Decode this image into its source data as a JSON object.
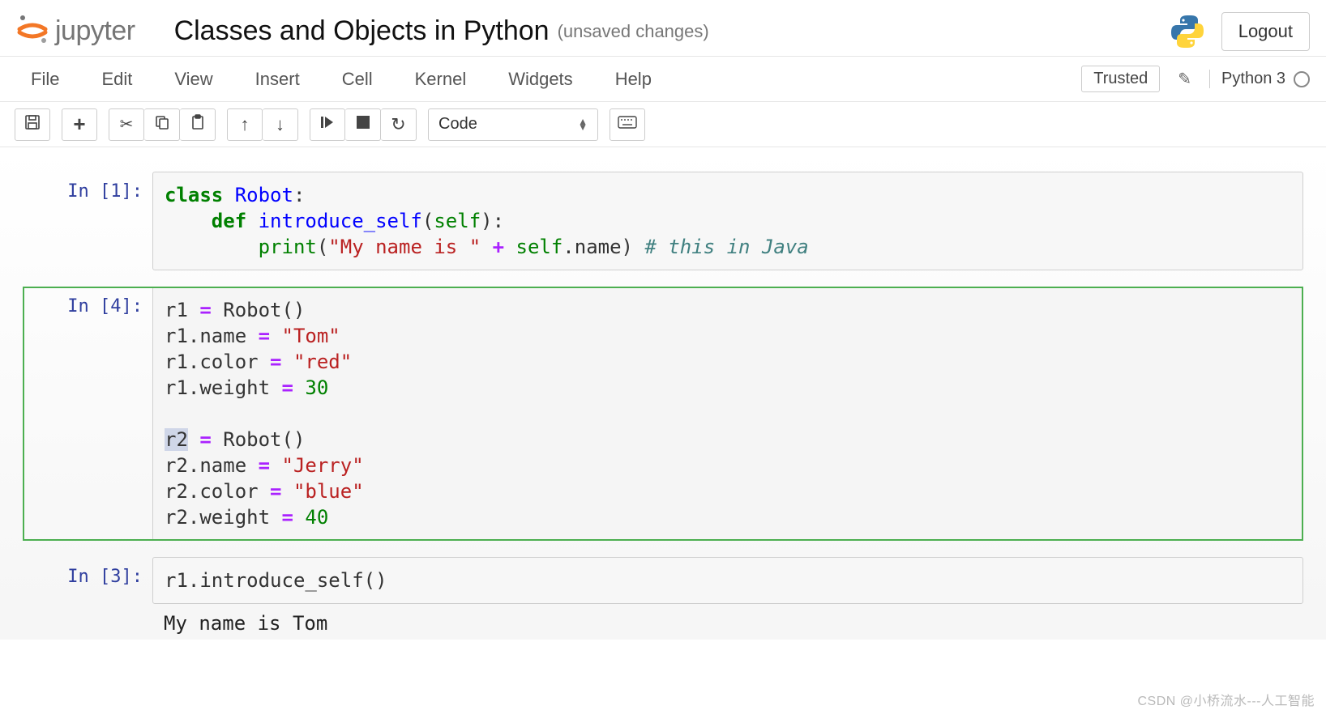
{
  "header": {
    "brand": "jupyter",
    "notebook_title": "Classes and Objects in Python",
    "status": "(unsaved changes)",
    "logout": "Logout"
  },
  "menubar": {
    "items": [
      "File",
      "Edit",
      "View",
      "Insert",
      "Cell",
      "Kernel",
      "Widgets",
      "Help"
    ],
    "trusted": "Trusted",
    "kernel": "Python 3"
  },
  "toolbar": {
    "icons": {
      "save": "save-icon",
      "add": "add-cell-icon",
      "cut": "cut-icon",
      "copy": "copy-icon",
      "paste": "paste-icon",
      "up": "move-up-icon",
      "down": "move-down-icon",
      "run": "run-icon",
      "stop": "stop-icon",
      "restart": "restart-icon",
      "palette": "command-palette-icon"
    },
    "celltype": "Code"
  },
  "cells": [
    {
      "prompt": "In [1]:",
      "code_tokens": [
        {
          "t": "class ",
          "c": "kw"
        },
        {
          "t": "Robot",
          "c": "defname"
        },
        {
          "t": ":",
          "c": ""
        },
        {
          "t": "\n",
          "c": ""
        },
        {
          "t": "    ",
          "c": ""
        },
        {
          "t": "def ",
          "c": "kw"
        },
        {
          "t": "introduce_self",
          "c": "defname"
        },
        {
          "t": "(",
          "c": ""
        },
        {
          "t": "self",
          "c": "builtin"
        },
        {
          "t": "):",
          "c": ""
        },
        {
          "t": "\n",
          "c": ""
        },
        {
          "t": "        ",
          "c": ""
        },
        {
          "t": "print",
          "c": "builtin"
        },
        {
          "t": "(",
          "c": ""
        },
        {
          "t": "\"My name is \"",
          "c": "str"
        },
        {
          "t": " ",
          "c": ""
        },
        {
          "t": "+",
          "c": "op"
        },
        {
          "t": " self",
          "c": "builtin"
        },
        {
          "t": ".",
          "c": ""
        },
        {
          "t": "name",
          "c": ""
        },
        {
          "t": ") ",
          "c": ""
        },
        {
          "t": "# this in Java",
          "c": "comment"
        }
      ]
    },
    {
      "prompt": "In [4]:",
      "selected": true,
      "code_tokens": [
        {
          "t": "r1 ",
          "c": ""
        },
        {
          "t": "=",
          "c": "op"
        },
        {
          "t": " Robot()",
          "c": ""
        },
        {
          "t": "\n",
          "c": ""
        },
        {
          "t": "r1",
          "c": ""
        },
        {
          "t": ".",
          "c": ""
        },
        {
          "t": "name ",
          "c": ""
        },
        {
          "t": "=",
          "c": "op"
        },
        {
          "t": " ",
          "c": ""
        },
        {
          "t": "\"Tom\"",
          "c": "str"
        },
        {
          "t": "\n",
          "c": ""
        },
        {
          "t": "r1",
          "c": ""
        },
        {
          "t": ".",
          "c": ""
        },
        {
          "t": "color ",
          "c": ""
        },
        {
          "t": "=",
          "c": "op"
        },
        {
          "t": " ",
          "c": ""
        },
        {
          "t": "\"red\"",
          "c": "str"
        },
        {
          "t": "\n",
          "c": ""
        },
        {
          "t": "r1",
          "c": ""
        },
        {
          "t": ".",
          "c": ""
        },
        {
          "t": "weight ",
          "c": ""
        },
        {
          "t": "=",
          "c": "op"
        },
        {
          "t": " ",
          "c": ""
        },
        {
          "t": "30",
          "c": "num"
        },
        {
          "t": "\n",
          "c": ""
        },
        {
          "t": "\n",
          "c": ""
        },
        {
          "t": "r2",
          "c": "sel"
        },
        {
          "t": " ",
          "c": ""
        },
        {
          "t": "=",
          "c": "op"
        },
        {
          "t": " Robot()",
          "c": ""
        },
        {
          "t": "\n",
          "c": ""
        },
        {
          "t": "r2",
          "c": ""
        },
        {
          "t": ".",
          "c": ""
        },
        {
          "t": "name ",
          "c": ""
        },
        {
          "t": "=",
          "c": "op"
        },
        {
          "t": " ",
          "c": ""
        },
        {
          "t": "\"Jerry\"",
          "c": "str"
        },
        {
          "t": "\n",
          "c": ""
        },
        {
          "t": "r2",
          "c": ""
        },
        {
          "t": ".",
          "c": ""
        },
        {
          "t": "color ",
          "c": ""
        },
        {
          "t": "=",
          "c": "op"
        },
        {
          "t": " ",
          "c": ""
        },
        {
          "t": "\"blue\"",
          "c": "str"
        },
        {
          "t": "\n",
          "c": ""
        },
        {
          "t": "r2",
          "c": ""
        },
        {
          "t": ".",
          "c": ""
        },
        {
          "t": "weight ",
          "c": ""
        },
        {
          "t": "=",
          "c": "op"
        },
        {
          "t": " ",
          "c": ""
        },
        {
          "t": "40",
          "c": "num"
        }
      ]
    },
    {
      "prompt": "In [3]:",
      "code_tokens": [
        {
          "t": "r1",
          "c": ""
        },
        {
          "t": ".",
          "c": ""
        },
        {
          "t": "introduce_self()",
          "c": ""
        }
      ],
      "output": "My name is Tom"
    }
  ],
  "watermark": "CSDN @小桥流水---人工智能"
}
